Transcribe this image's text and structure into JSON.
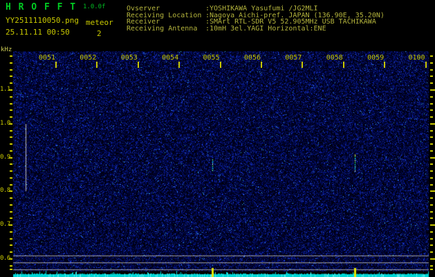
{
  "app": {
    "title": "H R O F F T",
    "version": "1.0.0f",
    "filename": "YY2511110050.png",
    "mode": "meteor",
    "datetime": "25.11.11 00:50",
    "echo_count": "2"
  },
  "station_info": [
    {
      "label": "Ovserver",
      "value": ":YOSHIKAWA Yasufumi /JG2MLI"
    },
    {
      "label": "Receiving Location",
      "value": ":Nagoya Aichi-pref. JAPAN (136.90E, 35.20N)"
    },
    {
      "label": "Receiver",
      "value": ":SMArt RTL-SDR V5 52.905MHz USB TACHIKAWA"
    },
    {
      "label": "Receiving Antenna",
      "value": ":10mH 3el.YAGI Horizontal:ENE"
    }
  ],
  "colors": {
    "background": "#000000",
    "title_green": "#00cc22",
    "header_yellow": "#c8c800",
    "info_olive": "#b4b43c",
    "axis_tick_yellow": "#c8c800",
    "khz_label": "#cccc55",
    "grid_gray": "#a0a0a0",
    "marker_gray": "#c0c0c0",
    "level_strip_cyan": "#00d4d4",
    "spike_yellow": "#e6e600",
    "noise_blue": "#0000aa"
  },
  "chart_data": {
    "type": "heatmap",
    "title": "HROFFT 10-minute radio meteor echo spectrogram",
    "x_axis": {
      "unit": "hhmm",
      "tick_labels": [
        "0051",
        "0052",
        "0053",
        "0054",
        "0055",
        "0056",
        "0057",
        "0058",
        "0059",
        "0100"
      ],
      "range": [
        "0050",
        "0100"
      ],
      "minutes_per_div": 1
    },
    "y_axis": {
      "unit_label": "kHz",
      "tick_labels": [
        "1.1",
        "1.0",
        "0.9",
        "0.8",
        "0.7",
        "0.6"
      ],
      "tick_values_khz": [
        1.1,
        1.0,
        0.9,
        0.8,
        0.7,
        0.6
      ],
      "range_khz": [
        0.56,
        1.21
      ],
      "minor_tick_step_khz": 0.02
    },
    "count_band_khz": [
      1.0,
      0.8
    ],
    "horizontal_marker_lines_khz": [
      0.61,
      0.59,
      0.57
    ],
    "echo_count": 2,
    "echoes": [
      {
        "time_hhmm": "0054.8",
        "time_min_after_0050": 4.8,
        "freq_khz_span": [
          0.86,
          0.9
        ]
      },
      {
        "time_hhmm": "0058.3",
        "time_min_after_0050": 8.27,
        "freq_khz_span": [
          0.86,
          0.91
        ]
      }
    ],
    "level_strip": {
      "description": "relative signal level meter",
      "spikes_min_after_0050": [
        4.8,
        8.27
      ]
    }
  }
}
